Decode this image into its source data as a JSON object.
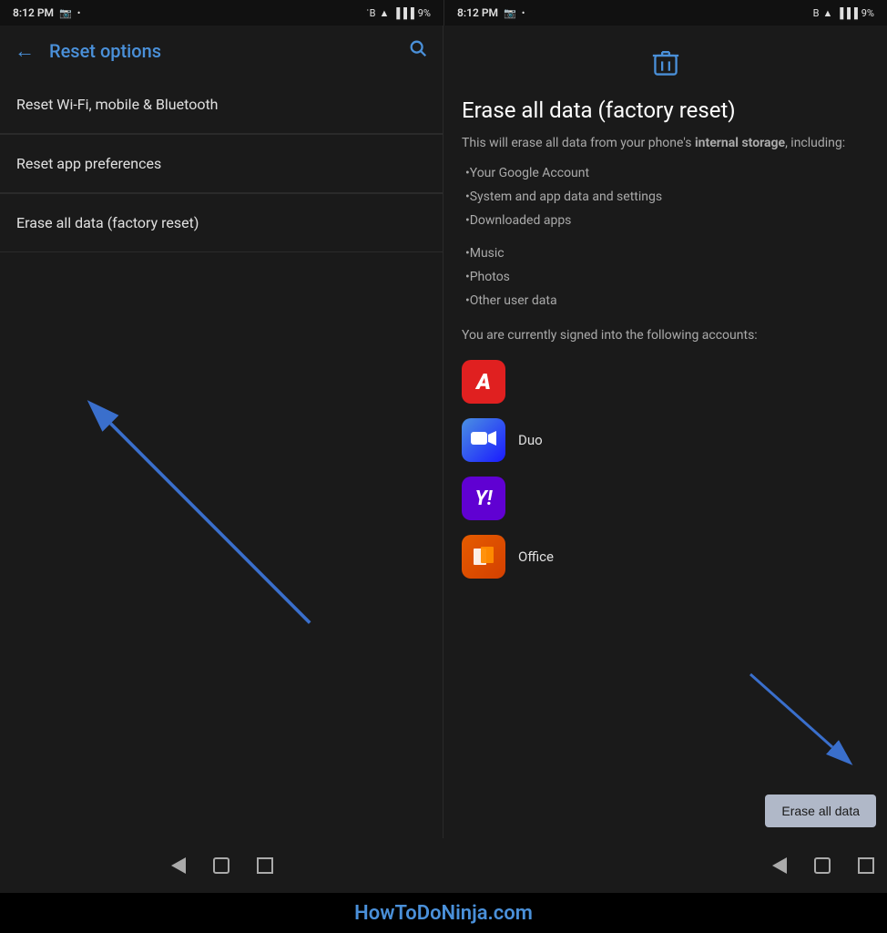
{
  "left_status": {
    "time": "8:12 PM",
    "camera_icon": "📷",
    "dot": "•",
    "bluetooth": "bluetooth",
    "wifi": "wifi",
    "signal": "signal",
    "battery": "9%"
  },
  "right_status": {
    "time": "8:12 PM",
    "camera_icon": "📷",
    "dot": "•",
    "bluetooth": "bluetooth",
    "wifi": "wifi",
    "signal": "signal",
    "battery": "9%"
  },
  "left_panel": {
    "back_label": "←",
    "title": "Reset options",
    "search_icon": "🔍",
    "menu_items": [
      {
        "label": "Reset Wi-Fi, mobile & Bluetooth"
      },
      {
        "label": "Reset app preferences"
      },
      {
        "label": "Erase all data (factory reset)"
      }
    ]
  },
  "right_panel": {
    "trash_icon": "🗑",
    "title": "Erase all data (factory reset)",
    "description_prefix": "This will erase all data from your phone's ",
    "description_bold": "internal storage",
    "description_suffix": ", including:",
    "bullet_items": [
      "•Your Google Account",
      "•System and app data and settings",
      "•Downloaded apps",
      "•Music",
      "•Photos",
      "•Other user data"
    ],
    "accounts_text": "You are currently signed into the following accounts:",
    "accounts": [
      {
        "name": "Adobe",
        "icon_type": "adobe",
        "label": ""
      },
      {
        "name": "Duo",
        "icon_type": "duo",
        "label": "Duo"
      },
      {
        "name": "Yahoo",
        "icon_type": "yahoo",
        "label": ""
      },
      {
        "name": "Office",
        "icon_type": "office",
        "label": "Office"
      }
    ],
    "erase_button_label": "Erase all data"
  },
  "brand": {
    "text": "HowToDoNinja.com"
  }
}
